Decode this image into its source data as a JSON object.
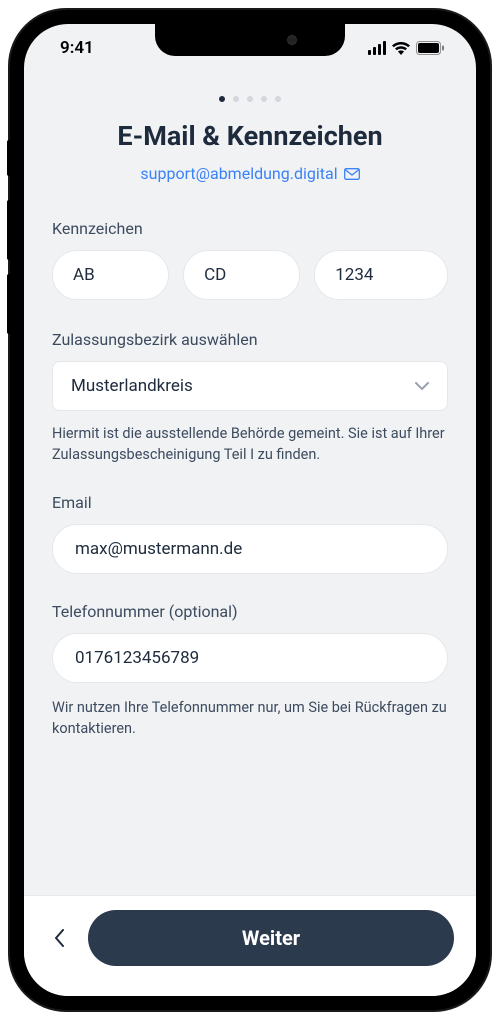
{
  "statusBar": {
    "time": "9:41"
  },
  "pagination": {
    "current": 1,
    "total": 5
  },
  "header": {
    "title": "E-Mail & Kennzeichen",
    "supportEmail": "support@abmeldung.digital"
  },
  "plate": {
    "label": "Kennzeichen",
    "part1": "AB",
    "part2": "CD",
    "part3": "1234"
  },
  "district": {
    "label": "Zulassungsbezirk auswählen",
    "value": "Musterlandkreis",
    "help": "Hiermit ist die ausstellende Behörde gemeint. Sie ist auf Ihrer Zulassungsbescheinigung Teil I zu finden."
  },
  "email": {
    "label": "Email",
    "value": "max@mustermann.de"
  },
  "phone": {
    "label": "Telefonnummer (optional)",
    "value": "0176123456789",
    "help": "Wir nutzen Ihre Telefonnummer nur, um Sie bei Rückfragen zu kontaktieren."
  },
  "footer": {
    "nextLabel": "Weiter"
  }
}
